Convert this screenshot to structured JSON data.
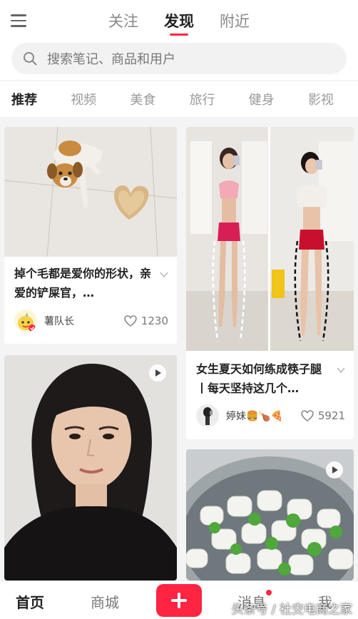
{
  "header": {
    "menu_icon": "hamburger-menu-icon",
    "tabs": [
      {
        "label": "关注",
        "active": false
      },
      {
        "label": "发现",
        "active": true
      },
      {
        "label": "附近",
        "active": false
      }
    ]
  },
  "search": {
    "icon": "search-icon",
    "placeholder": "搜索笔记、商品和用户"
  },
  "categories": [
    {
      "label": "推荐",
      "active": true
    },
    {
      "label": "视频",
      "active": false
    },
    {
      "label": "美食",
      "active": false
    },
    {
      "label": "旅行",
      "active": false
    },
    {
      "label": "健身",
      "active": false
    },
    {
      "label": "影视",
      "active": false
    }
  ],
  "feed": {
    "left": [
      {
        "title": "掉个毛都是爱你的形状，亲爱的铲屎官，…",
        "author": "薯队长",
        "likes": "1230",
        "image": "dog-and-heart-shaped-fur-photo",
        "is_video": false
      },
      {
        "title": "",
        "author": "",
        "likes": "",
        "image": "woman-short-hair-selfie-video",
        "is_video": true
      }
    ],
    "right": [
      {
        "title": "女生夏天如何练成筷子腿丨每天坚持这几个…",
        "author": "婷妹🍔🍗🍕",
        "likes": "5921",
        "image": "fitness-mirror-selfie-comparison",
        "is_video": false
      },
      {
        "title": "",
        "author": "",
        "likes": "",
        "image": "bowl-of-marshmallows-video",
        "is_video": true
      }
    ]
  },
  "bottom_nav": {
    "items": [
      {
        "label": "首页",
        "active": true
      },
      {
        "label": "商城",
        "active": false
      },
      {
        "label": "消息",
        "active": false,
        "badge_dot": true
      },
      {
        "label": "我",
        "active": false
      }
    ],
    "publish_icon": "plus-icon"
  },
  "watermark": "头条号 / 社交电商之家",
  "colors": {
    "accent": "#ff2442",
    "background": "#f4f4f4"
  }
}
